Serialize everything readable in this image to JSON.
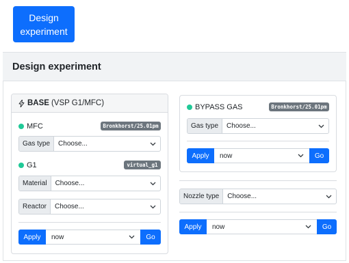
{
  "top_button": {
    "label": "Design experiment"
  },
  "panel": {
    "title": "Design experiment"
  },
  "base_card": {
    "bold_label": "BASE",
    "subtitle": "(VSP G1/MFC)",
    "icon": "lightning-icon",
    "mfc": {
      "name": "MFC",
      "badge": "Bronkhorst/25.01pm",
      "status_color": "#20c997"
    },
    "gas_type": {
      "label": "Gas type",
      "value": "Choose..."
    },
    "g1": {
      "name": "G1",
      "badge": "virtual_g1",
      "status_color": "#20c997"
    },
    "material": {
      "label": "Material",
      "value": "Choose..."
    },
    "reactor": {
      "label": "Reactor",
      "value": "Choose..."
    },
    "apply": {
      "button": "Apply",
      "time": "now",
      "go": "Go"
    }
  },
  "bypass": {
    "name": "BYPASS GAS",
    "badge": "Bronkhorst/25.01pm",
    "status_color": "#20c997",
    "gas_type": {
      "label": "Gas type",
      "value": "Choose..."
    },
    "apply": {
      "button": "Apply",
      "time": "now",
      "go": "Go"
    }
  },
  "nozzle": {
    "label": "Nozzle type",
    "value": "Choose..."
  },
  "global_apply": {
    "button": "Apply",
    "time": "now",
    "go": "Go"
  },
  "colors": {
    "primary": "#0d6efd",
    "status": "#20c997",
    "badge": "#6c757d"
  }
}
